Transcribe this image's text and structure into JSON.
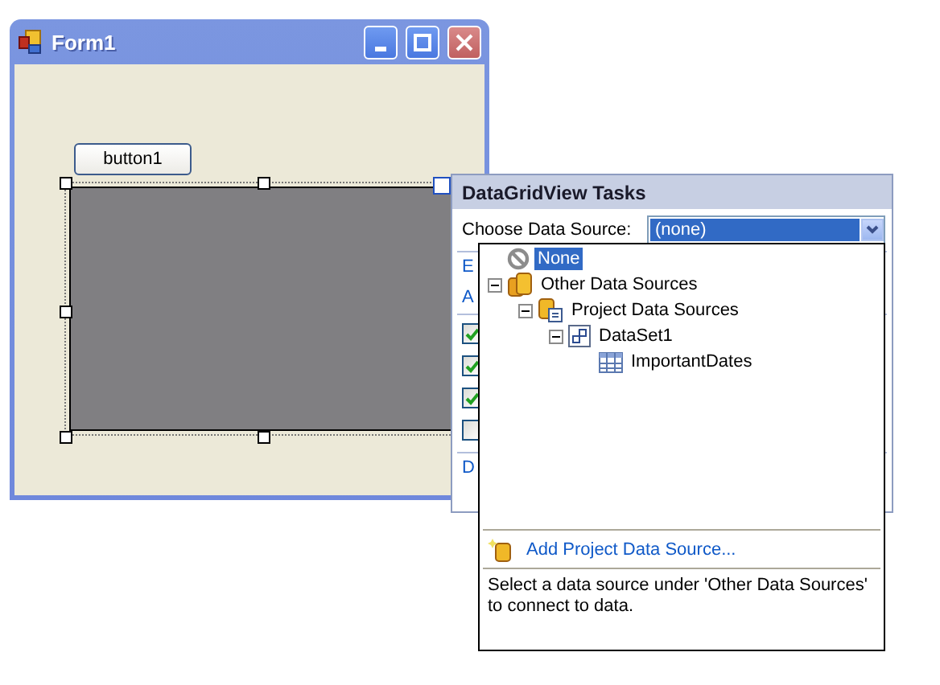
{
  "form": {
    "title": "Form1",
    "button": "button1"
  },
  "tasks": {
    "title": "DataGridView Tasks",
    "source_label": "Choose Data Source:",
    "source_value": "(none)",
    "links_top": [
      "E",
      "A"
    ],
    "options": [
      {
        "checked": true
      },
      {
        "checked": true
      },
      {
        "checked": true
      },
      {
        "checked": false
      }
    ],
    "link_bottom": "D"
  },
  "dropdown": {
    "tree": [
      {
        "label": "None",
        "kind": "none",
        "selected": true
      },
      {
        "label": "Other Data Sources",
        "kind": "sources",
        "selected": false,
        "expanded": true,
        "children": [
          {
            "label": "Project Data Sources",
            "kind": "project",
            "selected": false,
            "expanded": true,
            "children": [
              {
                "label": "DataSet1",
                "kind": "dataset",
                "selected": false,
                "expanded": true,
                "children": [
                  {
                    "label": "ImportantDates",
                    "kind": "table",
                    "selected": false
                  }
                ]
              }
            ]
          }
        ]
      }
    ],
    "add_link": "Add Project Data Source...",
    "hint": "Select a data source under 'Other Data Sources' to connect to data."
  }
}
